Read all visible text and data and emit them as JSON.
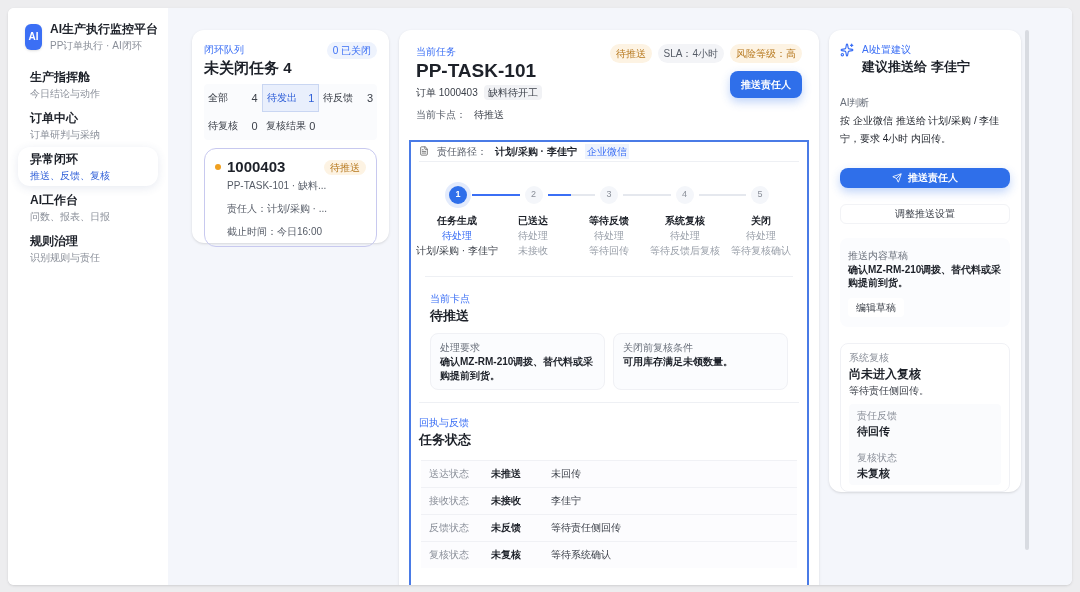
{
  "brand": {
    "logo": "AI",
    "title": "AI生产执行监控平台",
    "subtitle": "PP订单执行 · AI闭环"
  },
  "nav": [
    {
      "title": "生产指挥舱",
      "subtitle": "今日结论与动作",
      "selected": false
    },
    {
      "title": "订单中心",
      "subtitle": "订单研判与采纳",
      "selected": false
    },
    {
      "title": "异常闭环",
      "subtitle": "推送、反馈、复核",
      "selected": true
    },
    {
      "title": "AI工作台",
      "subtitle": "问数、报表、日报",
      "selected": false
    },
    {
      "title": "规则治理",
      "subtitle": "识别规则与责任",
      "selected": false
    }
  ],
  "queue": {
    "label": "闭环队列",
    "closed_badge": "0 已关闭",
    "title": "未关闭任务 4",
    "filters": [
      {
        "label": "全部",
        "count": "4",
        "selected": false
      },
      {
        "label": "待发出",
        "count": "1",
        "selected": true
      },
      {
        "label": "待反馈",
        "count": "3",
        "selected": false
      },
      {
        "label": "待复核",
        "count": "0",
        "selected": false
      },
      {
        "label": "复核结果",
        "count": "0",
        "selected": false
      }
    ],
    "tasks": [
      {
        "order": "1000403",
        "status": "待推送",
        "color": "#f0a020",
        "subtitle": "PP-TASK-101 · 缺料...",
        "owner": "责任人：计划/采购 · ...",
        "deadline": "截止时间：今日16:00"
      }
    ]
  },
  "task": {
    "label": "当前任务",
    "id": "PP-TASK-101",
    "order": "订单 1000403",
    "tag": "缺料待开工",
    "checkpoint_label": "当前卡点：",
    "checkpoint": "待推送",
    "badges": [
      {
        "text": "待推送",
        "kind": "warn"
      },
      {
        "text": "SLA：4小时",
        "kind": "neutral"
      },
      {
        "text": "风险等级：高",
        "kind": "warn"
      }
    ],
    "push_button": "推送责任人",
    "route_label": "责任路径：",
    "route": "计划/采购 · 李佳宁",
    "channel": "企业微信",
    "connectors": [
      {
        "level": 1
      },
      {
        "level": 0.5
      },
      {
        "level": 0
      },
      {
        "level": 0
      }
    ],
    "steps": [
      {
        "number": "1",
        "title": "任务生成",
        "status": "待处理",
        "note": "计划/采购 · 李佳宁",
        "selected": true
      },
      {
        "number": "2",
        "title": "已送达",
        "status": "待处理",
        "note": "未接收",
        "selected": false
      },
      {
        "number": "3",
        "title": "等待反馈",
        "status": "待处理",
        "note": "等待回传",
        "selected": false
      },
      {
        "number": "4",
        "title": "系统复核",
        "status": "待处理",
        "note": "等待反馈后复核",
        "selected": false
      },
      {
        "number": "5",
        "title": "关闭",
        "status": "待处理",
        "note": "等待复核确认",
        "selected": false
      }
    ],
    "current": {
      "label": "当前卡点",
      "title": "待推送",
      "cards": [
        {
          "label": "处理要求",
          "text": "确认MZ-RM-210调拨、替代料或采购提前到货。"
        },
        {
          "label": "关闭前复核条件",
          "text": "可用库存满足未领数量。"
        }
      ]
    },
    "feedback": {
      "label": "回执与反馈",
      "title": "任务状态",
      "rows": [
        {
          "label": "送达状态",
          "value": "未推送",
          "note": "未回传"
        },
        {
          "label": "接收状态",
          "value": "未接收",
          "note": "李佳宁"
        },
        {
          "label": "反馈状态",
          "value": "未反馈",
          "note": "等待责任侧回传"
        },
        {
          "label": "复核状态",
          "value": "未复核",
          "note": "等待系统确认"
        }
      ]
    }
  },
  "advice": {
    "label": "AI处置建议",
    "title": "建议推送给 李佳宁",
    "judgement_label": "AI判断",
    "judgement": "按 企业微信 推送给 计划/采购 / 李佳宁，要求 4小时 内回传。",
    "primary_button": "推送责任人",
    "secondary_button": "调整推送设置",
    "draft": {
      "label": "推送内容草稿",
      "text": "确认MZ-RM-210调拨、替代料或采购提前到货。",
      "button": "编辑草稿"
    },
    "review": {
      "label": "系统复核",
      "title": "尚未进入复核",
      "text": "等待责任侧回传。",
      "items": [
        {
          "label": "责任反馈",
          "value": "待回传"
        },
        {
          "label": "复核状态",
          "value": "未复核"
        }
      ]
    }
  }
}
